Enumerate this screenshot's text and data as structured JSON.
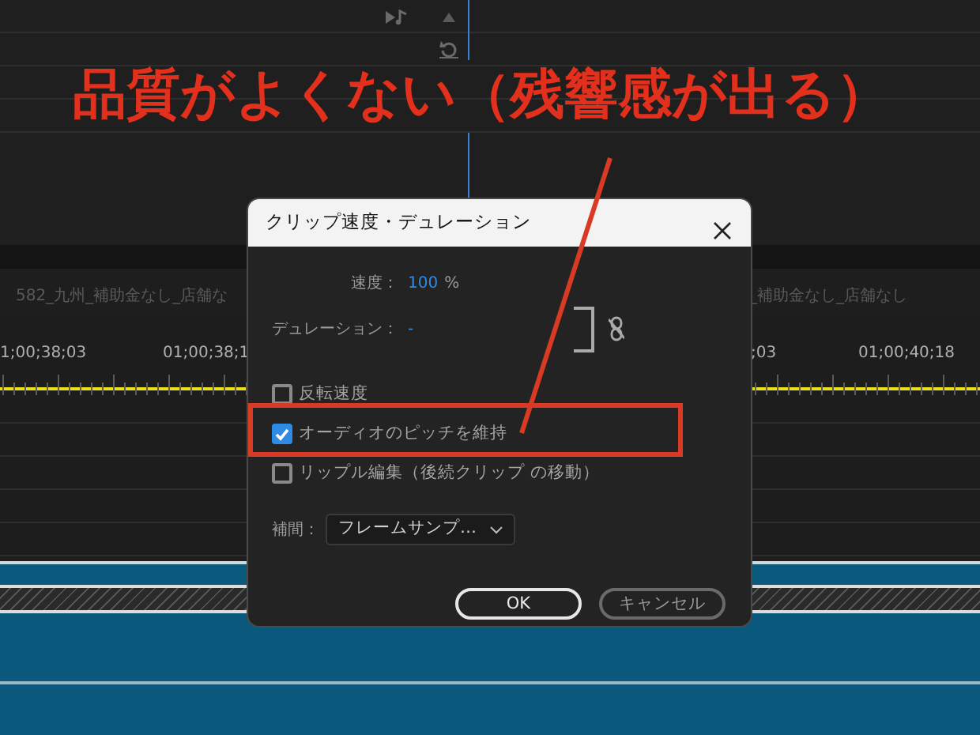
{
  "timeline": {
    "clip_labels": [
      "582_九州_補助金なし_店舗な",
      "_補助金なし_店舗なし"
    ],
    "timecodes": [
      "1;00;38;03",
      "01;00;38;1",
      ";03",
      "01;00;40;18"
    ]
  },
  "dialog": {
    "title": "クリップ速度・デュレーション",
    "speed_label": "速度：",
    "speed_value": "100",
    "speed_unit": "%",
    "duration_label": "デュレーション：",
    "duration_value": "-",
    "options": [
      {
        "label": "反転速度",
        "checked": false
      },
      {
        "label": "オーディオのピッチを維持",
        "checked": true
      },
      {
        "label": "リップル編集（後続クリップ の移動）",
        "checked": false
      }
    ],
    "interpolation": {
      "label": "補間：",
      "value": "フレームサンプ…"
    },
    "buttons": [
      {
        "label": "OK",
        "kind": "primary"
      },
      {
        "label": "キャンセル",
        "kind": "secondary"
      }
    ]
  },
  "annotation": {
    "text": "品質がよくない（残響感が出る）"
  }
}
